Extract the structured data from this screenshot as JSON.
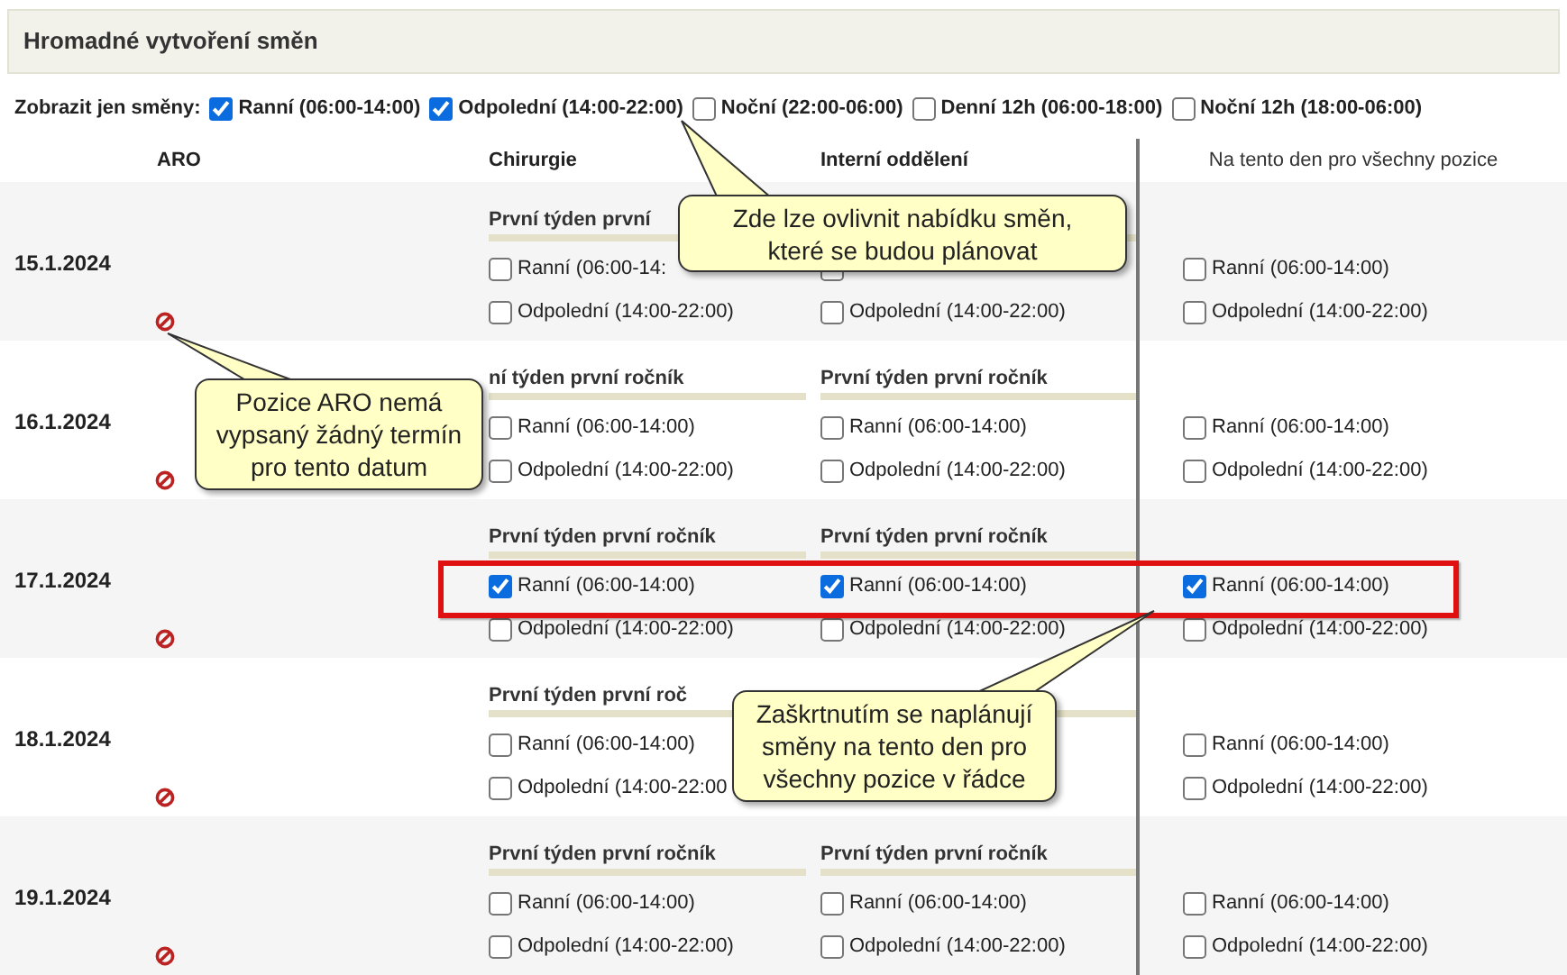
{
  "title": "Hromadné vytvoření směn",
  "filter": {
    "label": "Zobrazit jen směny:",
    "options": [
      {
        "label": "Ranní (06:00-14:00)",
        "checked": true
      },
      {
        "label": "Odpolední (14:00-22:00)",
        "checked": true
      },
      {
        "label": "Noční (22:00-06:00)",
        "checked": false
      },
      {
        "label": "Denní 12h (06:00-18:00)",
        "checked": false
      },
      {
        "label": "Noční 12h (18:00-06:00)",
        "checked": false
      }
    ]
  },
  "columns": [
    "ARO",
    "Chirurgie",
    "Interní oddělení",
    "Na tento den pro všechny pozice"
  ],
  "rows": [
    {
      "date": "15.1.2024",
      "aro_unavailable": true,
      "positions": [
        {
          "heading": "První týden první",
          "shifts": [
            {
              "label": "Ranní (06:00-14:",
              "checked": false
            },
            {
              "label": "Odpolední (14:00-22:00)",
              "checked": false
            }
          ]
        },
        {
          "shifts": [
            {
              "checked": false
            },
            {
              "label": "Odpolední (14:00-22:00)",
              "checked": false
            }
          ]
        }
      ],
      "all_positions": [
        {
          "label": "Ranní (06:00-14:00)",
          "checked": false
        },
        {
          "label": "Odpolední (14:00-22:00)",
          "checked": false
        }
      ]
    },
    {
      "date": "16.1.2024",
      "aro_unavailable": true,
      "positions": [
        {
          "heading": "ní týden první ročník",
          "shifts": [
            {
              "label": "Ranní (06:00-14:00)",
              "checked": false
            },
            {
              "label": "Odpolední (14:00-22:00)",
              "checked": false
            }
          ]
        },
        {
          "heading": "První týden první ročník",
          "shifts": [
            {
              "label": "Ranní (06:00-14:00)",
              "checked": false
            },
            {
              "label": "Odpolední (14:00-22:00)",
              "checked": false
            }
          ]
        }
      ],
      "all_positions": [
        {
          "label": "Ranní (06:00-14:00)",
          "checked": false
        },
        {
          "label": "Odpolední (14:00-22:00)",
          "checked": false
        }
      ]
    },
    {
      "date": "17.1.2024",
      "aro_unavailable": true,
      "positions": [
        {
          "heading": "První týden první ročník",
          "shifts": [
            {
              "label": "Ranní (06:00-14:00)",
              "checked": true
            },
            {
              "label": "Odpolední (14:00-22:00)",
              "checked": false
            }
          ]
        },
        {
          "heading": "První týden první ročník",
          "shifts": [
            {
              "label": "Ranní (06:00-14:00)",
              "checked": true
            },
            {
              "label": "Odpolední (14:00-22:00)",
              "checked": false
            }
          ]
        }
      ],
      "all_positions": [
        {
          "label": "Ranní (06:00-14:00)",
          "checked": true
        },
        {
          "label": "Odpolední (14:00-22:00)",
          "checked": false
        }
      ]
    },
    {
      "date": "18.1.2024",
      "aro_unavailable": true,
      "positions": [
        {
          "heading": "První týden první roč",
          "shifts": [
            {
              "label": "Ranní (06:00-14:00)",
              "checked": false
            },
            {
              "label": "Odpolední (14:00-22:00",
              "checked": false
            }
          ]
        }
      ],
      "all_positions": [
        {
          "label": "Ranní (06:00-14:00)",
          "checked": false
        },
        {
          "label": "Odpolední (14:00-22:00)",
          "checked": false
        }
      ]
    },
    {
      "date": "19.1.2024",
      "aro_unavailable": true,
      "positions": [
        {
          "heading": "První týden první ročník",
          "shifts": [
            {
              "label": "Ranní (06:00-14:00)",
              "checked": false
            },
            {
              "label": "Odpolední (14:00-22:00)",
              "checked": false
            }
          ]
        },
        {
          "heading": "První týden první ročník",
          "shifts": [
            {
              "label": "Ranní (06:00-14:00)",
              "checked": false
            },
            {
              "label": "Odpolední (14:00-22:00)",
              "checked": false
            }
          ]
        }
      ],
      "all_positions": [
        {
          "label": "Ranní (06:00-14:00)",
          "checked": false
        },
        {
          "label": "Odpolední (14:00-22:00)",
          "checked": false
        }
      ]
    }
  ],
  "annotations": [
    {
      "lines": [
        "Zde lze ovlivnit nabídku směn,",
        "které se budou plánovat"
      ]
    },
    {
      "lines": [
        "Pozice ARO nemá",
        "vypsaný žádný termín",
        "pro tento datum"
      ]
    },
    {
      "lines": [
        "Zaškrtnutím se naplánují",
        "směny na tento den pro",
        "všechny pozice v řádce"
      ]
    }
  ]
}
